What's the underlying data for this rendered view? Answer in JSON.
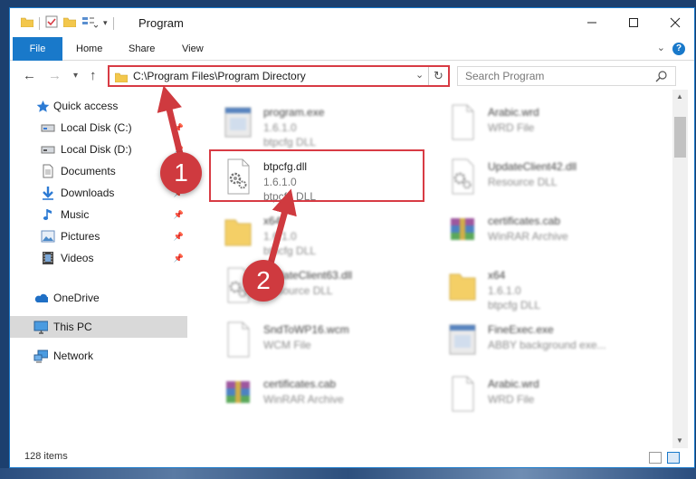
{
  "window": {
    "title": "Program"
  },
  "ribbon": {
    "file": "File",
    "home": "Home",
    "share": "Share",
    "view": "View",
    "help": "?"
  },
  "nav": {
    "back": "←",
    "forward": "→",
    "recent": "▾",
    "up": "↑",
    "path": "C:\\Program Files\\Program Directory",
    "dropdown": "⌄",
    "refresh": "↻",
    "search_placeholder": "Search Program"
  },
  "sidebar": {
    "items": [
      {
        "label": "Quick access",
        "icon": "star-icon",
        "pinned": false
      },
      {
        "label": "Local Disk (C:)",
        "icon": "drive-icon",
        "pinned": true
      },
      {
        "label": "Local Disk (D:)",
        "icon": "drive-icon",
        "pinned": true
      },
      {
        "label": "Documents",
        "icon": "documents-icon",
        "pinned": true
      },
      {
        "label": "Downloads",
        "icon": "downloads-icon",
        "pinned": true
      },
      {
        "label": "Music",
        "icon": "music-icon",
        "pinned": true
      },
      {
        "label": "Pictures",
        "icon": "pictures-icon",
        "pinned": true
      },
      {
        "label": "Videos",
        "icon": "videos-icon",
        "pinned": true
      },
      {
        "label": "OneDrive",
        "icon": "onedrive-icon",
        "pinned": false
      },
      {
        "label": "This PC",
        "icon": "this-pc-icon",
        "pinned": false,
        "selected": true
      },
      {
        "label": "Network",
        "icon": "network-icon",
        "pinned": false
      }
    ],
    "pin_glyph": "📌"
  },
  "files": [
    {
      "name": "program.exe",
      "line2": "1.6.1.0",
      "line3": "btpcfg DLL",
      "icon": "exe-icon",
      "blur": true
    },
    {
      "name": "Arabic.wrd",
      "line2": "WRD File",
      "line3": "",
      "icon": "document-icon",
      "blur": true
    },
    {
      "name": "btpcfg.dll",
      "line2": "1.6.1.0",
      "line3": "btpcfg DLL",
      "icon": "dll-gear-icon",
      "blur": false
    },
    {
      "name": "UpdateClient42.dll",
      "line2": "Resource DLL",
      "line3": "",
      "icon": "dll-gear-icon",
      "blur": true
    },
    {
      "name": "x64",
      "line2": "1.6.1.0",
      "line3": "btpcfg DLL",
      "icon": "folder-icon",
      "blur": true
    },
    {
      "name": "certificates.cab",
      "line2": "WinRAR Archive",
      "line3": "",
      "icon": "archive-icon",
      "blur": true
    },
    {
      "name": "UpdateClient63.dll",
      "line2": "Resource DLL",
      "line3": "",
      "icon": "dll-gear-icon",
      "blur": true
    },
    {
      "name": "x64",
      "line2": "1.6.1.0",
      "line3": "btpcfg DLL",
      "icon": "folder-icon",
      "blur": true
    },
    {
      "name": "SndToWP16.wcm",
      "line2": "WCM File",
      "line3": "",
      "icon": "document-icon",
      "blur": true
    },
    {
      "name": "FineExec.exe",
      "line2": "ABBY background exe...",
      "line3": "",
      "icon": "exe-icon",
      "blur": true
    },
    {
      "name": "certificates.cab",
      "line2": "WinRAR Archive",
      "line3": "",
      "icon": "archive-icon",
      "blur": true
    },
    {
      "name": "Arabic.wrd",
      "line2": "WRD File",
      "line3": "",
      "icon": "document-icon",
      "blur": true
    }
  ],
  "status": {
    "count": "128 items"
  },
  "annotations": {
    "step1": "1",
    "step2": "2"
  },
  "colors": {
    "accent": "#1979ca",
    "highlight": "#d83b44",
    "badge": "#cf3a3f",
    "selected": "#d9d9d9"
  }
}
